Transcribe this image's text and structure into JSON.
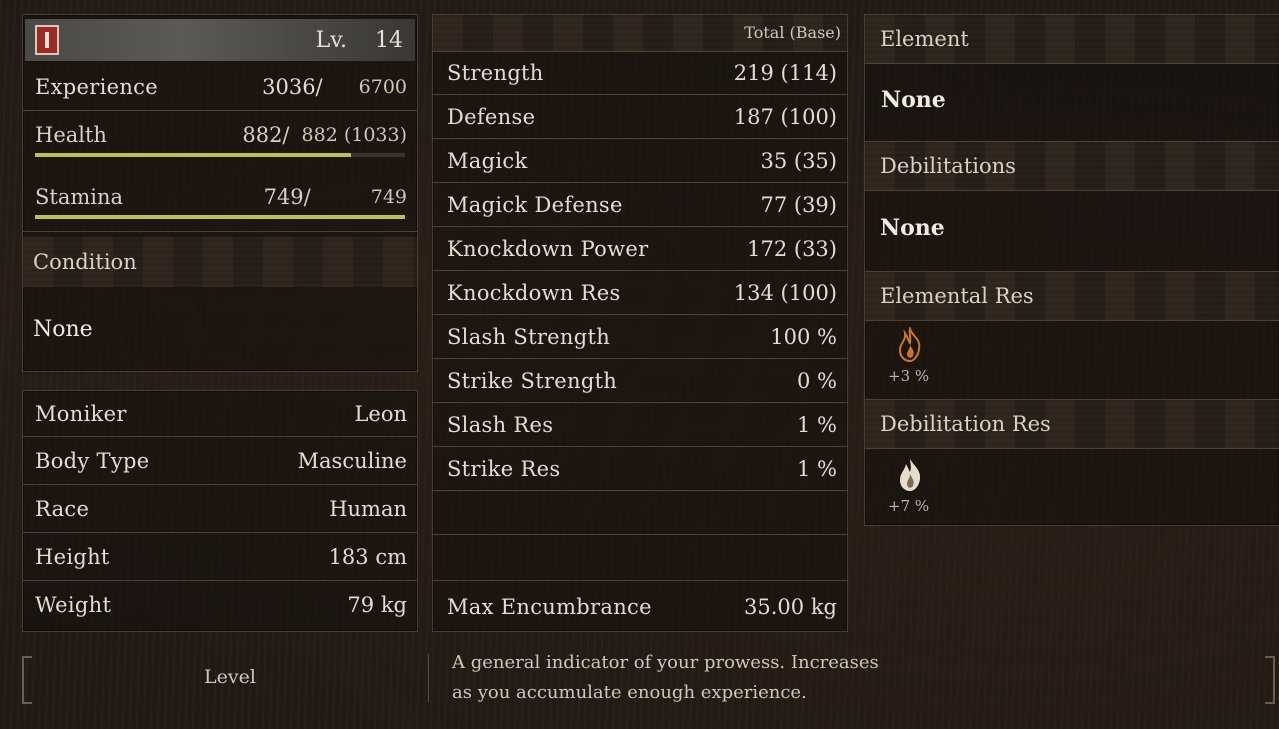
{
  "character": {
    "level_prefix": "Lv.",
    "level": "14",
    "experience_label": "Experience",
    "experience_current": "3036/",
    "experience_next": "6700",
    "health_label": "Health",
    "health_current": "882/",
    "health_max": "882 (1033)",
    "health_fill_fraction": 0.853,
    "stamina_label": "Stamina",
    "stamina_current": "749/",
    "stamina_max": "749",
    "stamina_fill_fraction": 1.0,
    "condition_label": "Condition",
    "condition_value": "None"
  },
  "profile": [
    {
      "label": "Moniker",
      "value": "Leon"
    },
    {
      "label": "Body Type",
      "value": "Masculine"
    },
    {
      "label": "Race",
      "value": "Human"
    },
    {
      "label": "Height",
      "value": "183 cm"
    },
    {
      "label": "Weight",
      "value": "79 kg"
    }
  ],
  "stats": {
    "header": "Total (Base)",
    "rows": [
      {
        "label": "Strength",
        "value": "219 (114)"
      },
      {
        "label": "Defense",
        "value": "187 (100)"
      },
      {
        "label": "Magick",
        "value": "35 (35)"
      },
      {
        "label": "Magick Defense",
        "value": "77 (39)"
      },
      {
        "label": "Knockdown Power",
        "value": "172 (33)"
      },
      {
        "label": "Knockdown Res",
        "value": "134 (100)"
      },
      {
        "label": "Slash Strength",
        "value": "100 %"
      },
      {
        "label": "Strike Strength",
        "value": "0 %"
      },
      {
        "label": "Slash Res",
        "value": "1 %"
      },
      {
        "label": "Strike Res",
        "value": "1 %"
      }
    ],
    "encumbrance_label": "Max Encumbrance",
    "encumbrance_value": "35.00 kg"
  },
  "status": {
    "element_label": "Element",
    "element_value": "None",
    "debilitations_label": "Debilitations",
    "debilitations_value": "None",
    "elemental_res_label": "Elemental Res",
    "elemental_res_icon": "fire-icon",
    "elemental_res_value": "+3 %",
    "debilitation_res_label": "Debilitation Res",
    "debilitation_res_icon": "burn-icon",
    "debilitation_res_value": "+7 %"
  },
  "help": {
    "selected": "Level",
    "description_line1": "A general indicator of your prowess. Increases",
    "description_line2": "as you accumulate enough experience."
  },
  "colors": {
    "bar_green": "#b9c25a",
    "fire_orange": "#c9762f",
    "emblem_red": "#9a2b25"
  }
}
